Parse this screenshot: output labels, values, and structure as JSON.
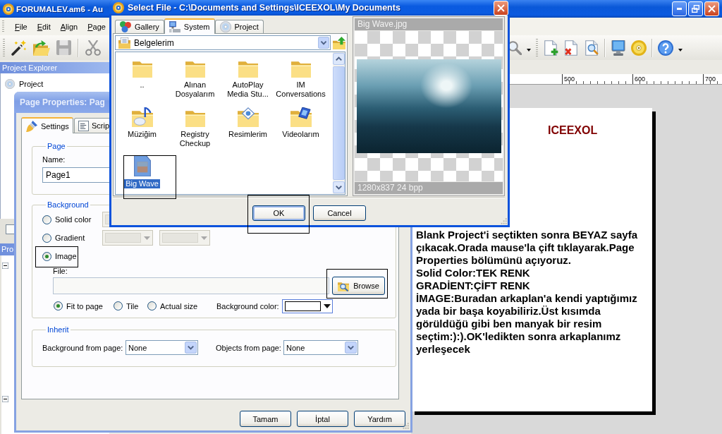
{
  "main_window": {
    "title": "FORUMALEV.am6 - Au",
    "menu": [
      "File",
      "Edit",
      "Align",
      "Page"
    ],
    "project_explorer": {
      "title": "Project Explorer",
      "tree": [
        {
          "label": "Project"
        }
      ]
    },
    "properties_panel": {
      "title": "Pro"
    },
    "ruler": [
      "500",
      "600",
      "700"
    ],
    "page": {
      "heading": "ICEEXOL",
      "paragraphs": [
        "Blank Project'i seçtikten sonra BEYAZ sayfa çıkacak.Orada mause'la çift tıklayarak.Page Properties bölümünü açıyoruz.",
        "Solid Color:TEK RENK",
        "GRADİENT:ÇİFT RENK",
        "İMAGE:Buradan arkaplan'a kendi yaptığımız yada bir başa koyabiliriz.Üst kısımda görüldüğü gibi ben manyak bir resim seçtim:):).OK'ledikten sonra arkaplanımz yerleşecek"
      ]
    }
  },
  "page_properties_dialog": {
    "title": "Page Properties: Pag",
    "tabs": [
      {
        "label": "Settings",
        "selected": true
      },
      {
        "label": "Scrip",
        "selected": false
      }
    ],
    "page_group": {
      "title": "Page",
      "name_label": "Name:",
      "name_value": "Page1"
    },
    "background_group": {
      "title": "Background",
      "options": [
        {
          "label": "Solid color",
          "kind": "solid",
          "selected": false,
          "annotated": false
        },
        {
          "label": "Gradient",
          "kind": "gradient",
          "selected": false,
          "annotated": false
        },
        {
          "label": "Image",
          "kind": "image",
          "selected": true,
          "annotated": true
        }
      ],
      "file_label": "File:",
      "browse_button": {
        "label": "Browse",
        "annotated": true
      },
      "fit_options": [
        {
          "label": "Fit to page",
          "selected": true
        },
        {
          "label": "Tile",
          "selected": false
        },
        {
          "label": "Actual size",
          "selected": false
        }
      ],
      "color_label": "Background color:"
    },
    "inherit_group": {
      "title": "Inherit",
      "fields": [
        {
          "label": "Background from page:",
          "value": "None"
        },
        {
          "label": "Objects from page:",
          "value": "None"
        }
      ]
    },
    "buttons": [
      "Tamam",
      "İptal",
      "Yardım"
    ]
  },
  "select_file_dialog": {
    "title": "Select File - C:\\Documents and Settings\\ICEEXOL\\My Documents",
    "tabs": [
      {
        "label": "Gallery",
        "selected": false
      },
      {
        "label": "System",
        "selected": true
      },
      {
        "label": "Project",
        "selected": false
      }
    ],
    "location": "Belgelerim",
    "files": [
      {
        "name": "..",
        "kind": "folder",
        "selected": false,
        "annotated": false
      },
      {
        "name": "Alınan Dosyalarım",
        "kind": "folder",
        "selected": false,
        "annotated": false
      },
      {
        "name": "AutoPlay Media Stu...",
        "kind": "folder",
        "selected": false,
        "annotated": false
      },
      {
        "name": "IM Conversations",
        "kind": "folder",
        "selected": false,
        "annotated": false
      },
      {
        "name": "Müziğim",
        "kind": "music_folder",
        "selected": false,
        "annotated": false
      },
      {
        "name": "Registry Checkup",
        "kind": "folder",
        "selected": false,
        "annotated": false
      },
      {
        "name": "Resimlerim",
        "kind": "pictures_folder",
        "selected": false,
        "annotated": false
      },
      {
        "name": "Videolarım",
        "kind": "video_folder",
        "selected": false,
        "annotated": false
      },
      {
        "name": "Big Wave",
        "kind": "image",
        "selected": true,
        "annotated": true
      }
    ],
    "preview": {
      "title": "Big Wave.jpg",
      "info": "1280x837 24 bpp"
    },
    "buttons": [
      {
        "label": "OK",
        "default": true,
        "annotated": true
      },
      {
        "label": "Cancel",
        "default": false,
        "annotated": false
      }
    ]
  }
}
